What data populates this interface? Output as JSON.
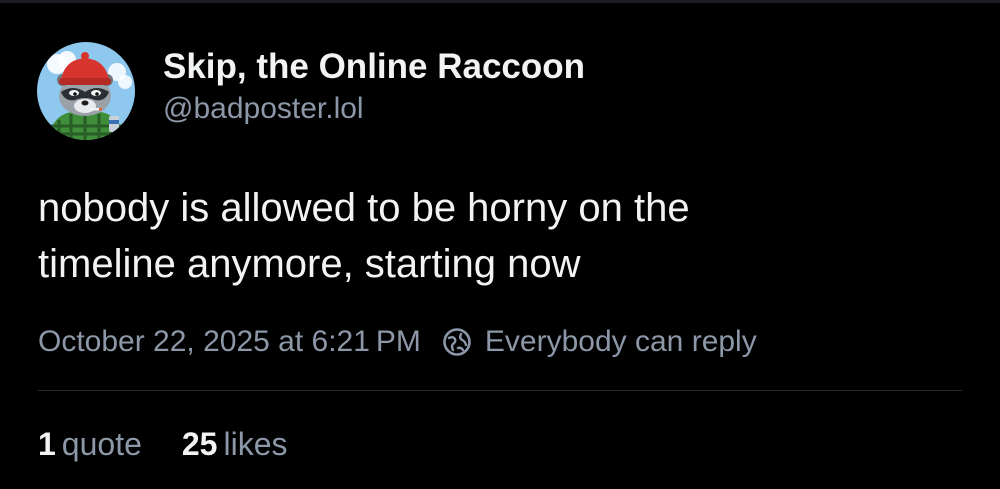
{
  "post": {
    "author": {
      "display_name": "Skip, the Online Raccoon",
      "handle": "@badposter.lol",
      "avatar_icon": "raccoon-avatar"
    },
    "text_lines": [
      "nobody is allowed to be horny on the",
      "timeline anymore, starting now"
    ],
    "timestamp": "October 22, 2025 at 6:21 PM",
    "reply_setting": {
      "icon": "globe-icon",
      "label": "Everybody can reply"
    },
    "stats": {
      "quotes": {
        "count": "1",
        "label": "quote"
      },
      "likes": {
        "count": "25",
        "label": "likes"
      }
    }
  },
  "colors": {
    "background": "#000000",
    "primary_text": "#f1f3f5",
    "secondary_text": "#8c97a7",
    "divider": "#26292f"
  }
}
